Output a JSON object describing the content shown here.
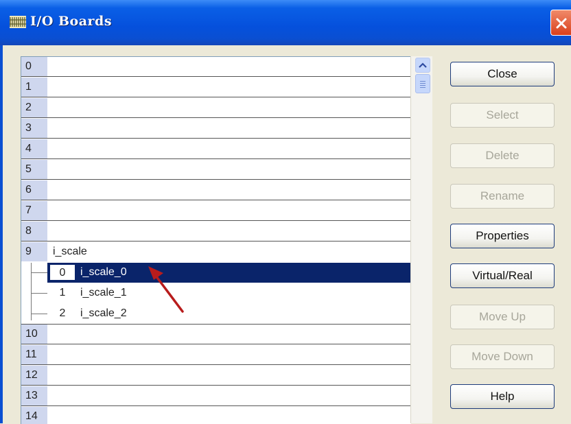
{
  "window": {
    "title": "I/O Boards"
  },
  "icons": {
    "title_icon": "grid-icon",
    "close_icon": "close-x-icon",
    "scroll_up": "chevron-up-icon",
    "annotation": "red-arrow-icon"
  },
  "colors": {
    "selection": "#0a246a",
    "titlebar": "#0a5fe6",
    "close": "#d9401c",
    "annotation_arrow": "#b81c1c"
  },
  "slots": [
    {
      "num": "0",
      "name": ""
    },
    {
      "num": "1",
      "name": ""
    },
    {
      "num": "2",
      "name": ""
    },
    {
      "num": "3",
      "name": ""
    },
    {
      "num": "4",
      "name": ""
    },
    {
      "num": "5",
      "name": ""
    },
    {
      "num": "6",
      "name": ""
    },
    {
      "num": "7",
      "name": ""
    },
    {
      "num": "8",
      "name": ""
    },
    {
      "num": "9",
      "name": "i_scale"
    },
    {
      "num": "0",
      "name": "i_scale_0"
    },
    {
      "num": "1",
      "name": "i_scale_1"
    },
    {
      "num": "2",
      "name": "i_scale_2"
    },
    {
      "num": "10",
      "name": ""
    },
    {
      "num": "11",
      "name": ""
    },
    {
      "num": "12",
      "name": ""
    },
    {
      "num": "13",
      "name": ""
    },
    {
      "num": "14",
      "name": ""
    }
  ],
  "buttons": {
    "close": "Close",
    "select": "Select",
    "delete": "Delete",
    "rename": "Rename",
    "properties": "Properties",
    "virtual_real": "Virtual/Real",
    "move_up": "Move Up",
    "move_down": "Move Down",
    "help": "Help"
  },
  "selected_item": "i_scale_0"
}
